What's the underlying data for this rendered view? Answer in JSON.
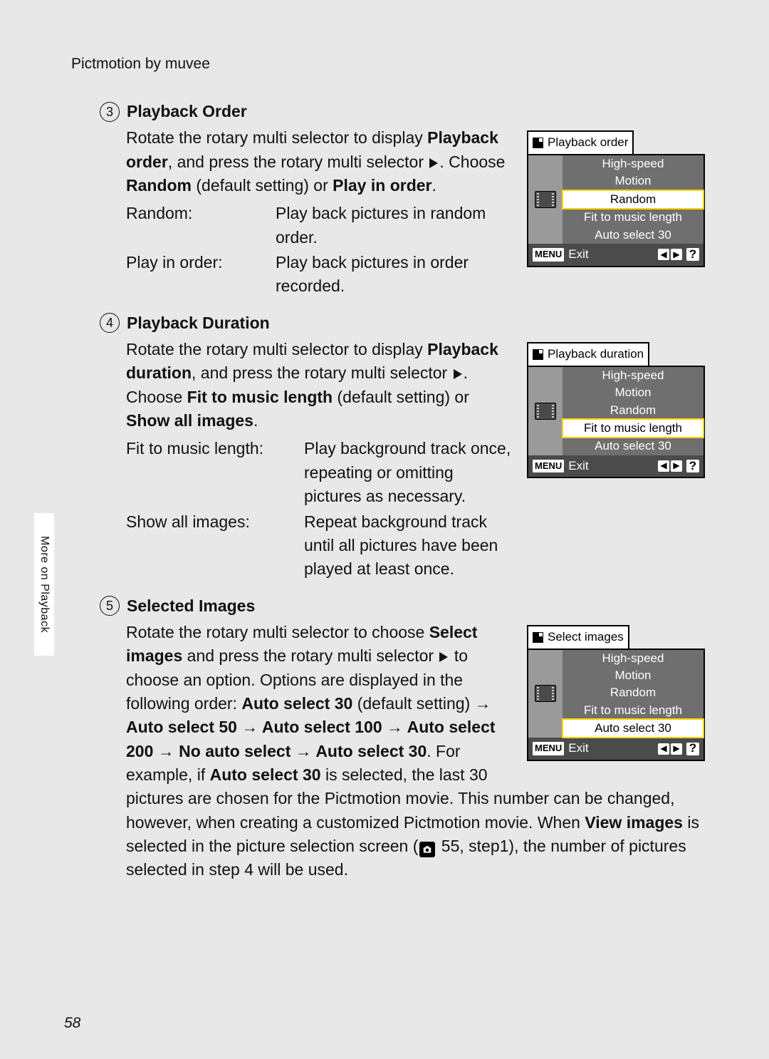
{
  "header": "Pictmotion by muvee",
  "sidebar_tab": "More on Playback",
  "page_number": "58",
  "lcd_common": {
    "rows": [
      "High-speed",
      "Motion",
      "Random",
      "Fit to music length",
      "Auto select 30"
    ],
    "exit_label": "Exit",
    "menu_label": "MENU",
    "help_label": "?"
  },
  "lcds": {
    "s3": {
      "title": "Playback order",
      "selected_index": 2
    },
    "s4": {
      "title": "Playback duration",
      "selected_index": 3
    },
    "s5": {
      "title": "Select images",
      "selected_index": 4
    }
  },
  "steps": {
    "s3": {
      "num": "3",
      "title": "Playback Order",
      "p1a": "Rotate the rotary multi selector to display ",
      "p1b": "Playback order",
      "p1c": ", and press the rotary multi selector ",
      "p1d": ". Choose ",
      "p1e": "Random",
      "p1f": " (default  setting) or ",
      "p1g": "Play in order",
      "p1h": ".",
      "def1_t": "Random:",
      "def1_d": "Play back pictures in random order.",
      "def2_t": "Play in order:",
      "def2_d": "Play back pictures in order recorded."
    },
    "s4": {
      "num": "4",
      "title": "Playback Duration",
      "p1a": "Rotate the rotary multi selector to display ",
      "p1b": "Playback duration",
      "p1c": ", and press the rotary multi selector ",
      "p1d": ". Choose ",
      "p1e": "Fit to music length",
      "p1f": " (default  setting) or ",
      "p1g": "Show all images",
      "p1h": ".",
      "def1_t": "Fit to music length:",
      "def1_d": "Play background track once, repeating or omitting pictures as necessary.",
      "def2_t": "Show all images:",
      "def2_d": "Repeat background track until all pictures have been played at least once."
    },
    "s5": {
      "num": "5",
      "title": "Selected Images",
      "p1a": "Rotate the rotary multi selector to choose ",
      "p1b": "Select images",
      "p1c": " and press the rotary multi selector ",
      "p1d": " to choose an option. Options are displayed in the following order: ",
      "p1e": "Auto select 30",
      "p1f": " (default setting) → ",
      "p1g": "Auto select 50",
      "p1h": " → ",
      "p1i": "Auto select 100",
      "p1j": " → ",
      "p1k": "Auto select 200",
      "p1l": " → ",
      "p1m": "No auto select",
      "p1n": " → ",
      "p1o": "Auto select 30",
      "p1p": ". For example, if ",
      "p1q": "Auto select 30",
      "p1r": " is selected, the last 30 pictures are chosen for the Pictmotion movie. This number can be changed, however, when creating a customized Pictmotion movie. When ",
      "p1s": "View images",
      "p1t": " is selected in the picture selection screen (",
      "p1u": " 55, step1), the number of pictures selected in step 4 will be used."
    }
  }
}
